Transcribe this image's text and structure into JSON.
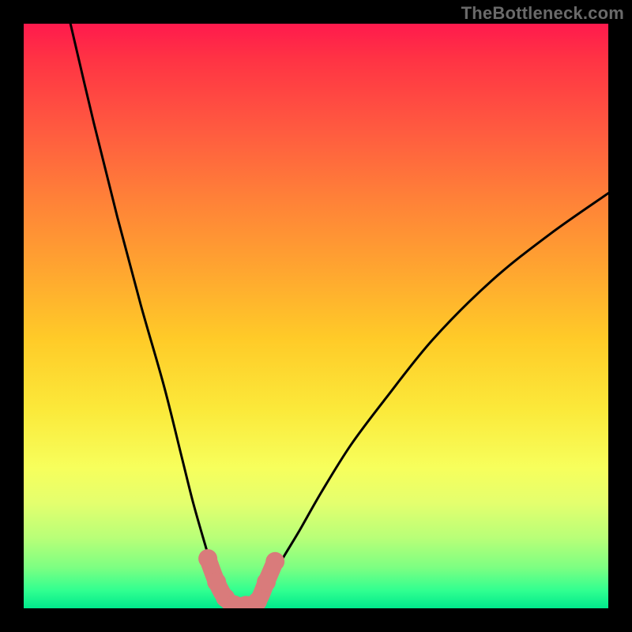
{
  "watermark": "TheBottleneck.com",
  "colors": {
    "background": "#000000",
    "curve_stroke": "#000000",
    "marker_fill": "#d97b7b",
    "marker_stroke": "#d97b7b",
    "gradient_top": "#ff1a4d",
    "gradient_bottom": "#00e98c"
  },
  "chart_data": {
    "type": "line",
    "title": "",
    "xlabel": "",
    "ylabel": "",
    "xlim": [
      0,
      100
    ],
    "ylim": [
      0,
      100
    ],
    "series": [
      {
        "name": "left-curve",
        "x": [
          8,
          12,
          16,
          20,
          24,
          27,
          29,
          31,
          32.5,
          34,
          35.5
        ],
        "y": [
          100,
          83,
          67,
          52,
          38,
          26,
          18,
          11,
          6,
          2.5,
          0.5
        ]
      },
      {
        "name": "right-curve",
        "x": [
          40,
          42,
          44,
          47,
          51,
          56,
          62,
          70,
          80,
          90,
          100
        ],
        "y": [
          1,
          4,
          8,
          13,
          20,
          28,
          36,
          46,
          56,
          64,
          71
        ]
      },
      {
        "name": "marker-segment",
        "x": [
          31.5,
          33,
          34.5,
          36,
          38,
          40,
          41.5,
          43
        ],
        "y": [
          8.5,
          4.5,
          1.8,
          0.6,
          0.5,
          1.2,
          4.5,
          8
        ]
      }
    ],
    "annotations": []
  }
}
